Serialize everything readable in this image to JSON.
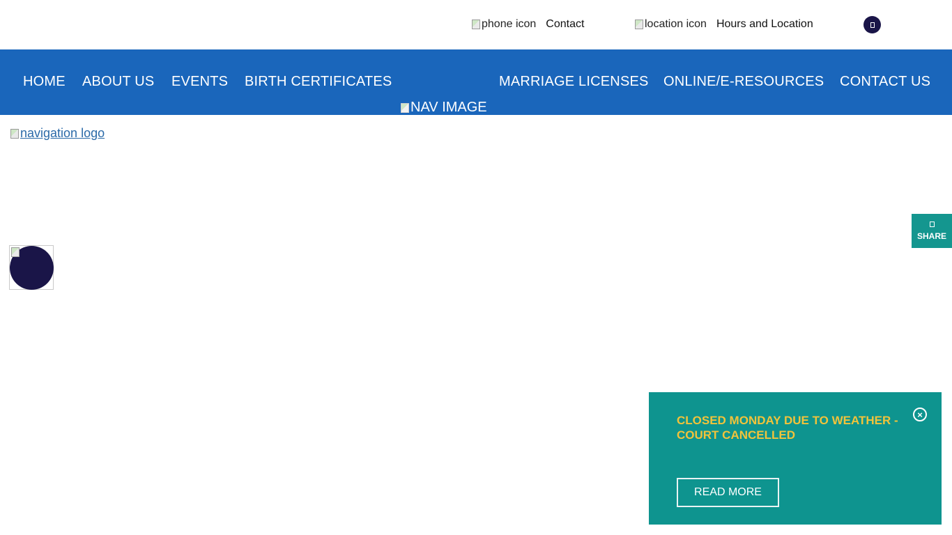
{
  "topbar": {
    "phone_icon_alt": "phone icon",
    "contact_label": "Contact",
    "location_icon_alt": "location icon",
    "hours_label": "Hours and Location"
  },
  "nav": {
    "items": [
      {
        "label": "HOME"
      },
      {
        "label": "ABOUT US"
      },
      {
        "label": "EVENTS"
      },
      {
        "label": "BIRTH CERTIFICATES"
      },
      {
        "label": "MARRIAGE LICENSES"
      },
      {
        "label": "ONLINE/E-RESOURCES"
      },
      {
        "label": "CONTACT US"
      }
    ],
    "nav_image_alt": "NAV IMAGE",
    "background_color": "#1a66bb"
  },
  "logo": {
    "alt": "navigation logo"
  },
  "share": {
    "label": "SHARE",
    "color": "#14968f"
  },
  "alert": {
    "title": "CLOSED MONDAY DUE TO WEATHER - COURT CANCELLED",
    "close_glyph": "×",
    "button_label": "READ MORE",
    "background_color": "#0e948f",
    "title_color": "#f2c33a"
  },
  "icons": {
    "top_circle": "menu-icon",
    "avatar": "avatar-icon",
    "share": "share-icon",
    "close": "close-icon"
  },
  "colors": {
    "dark_navy": "#1a1548"
  }
}
